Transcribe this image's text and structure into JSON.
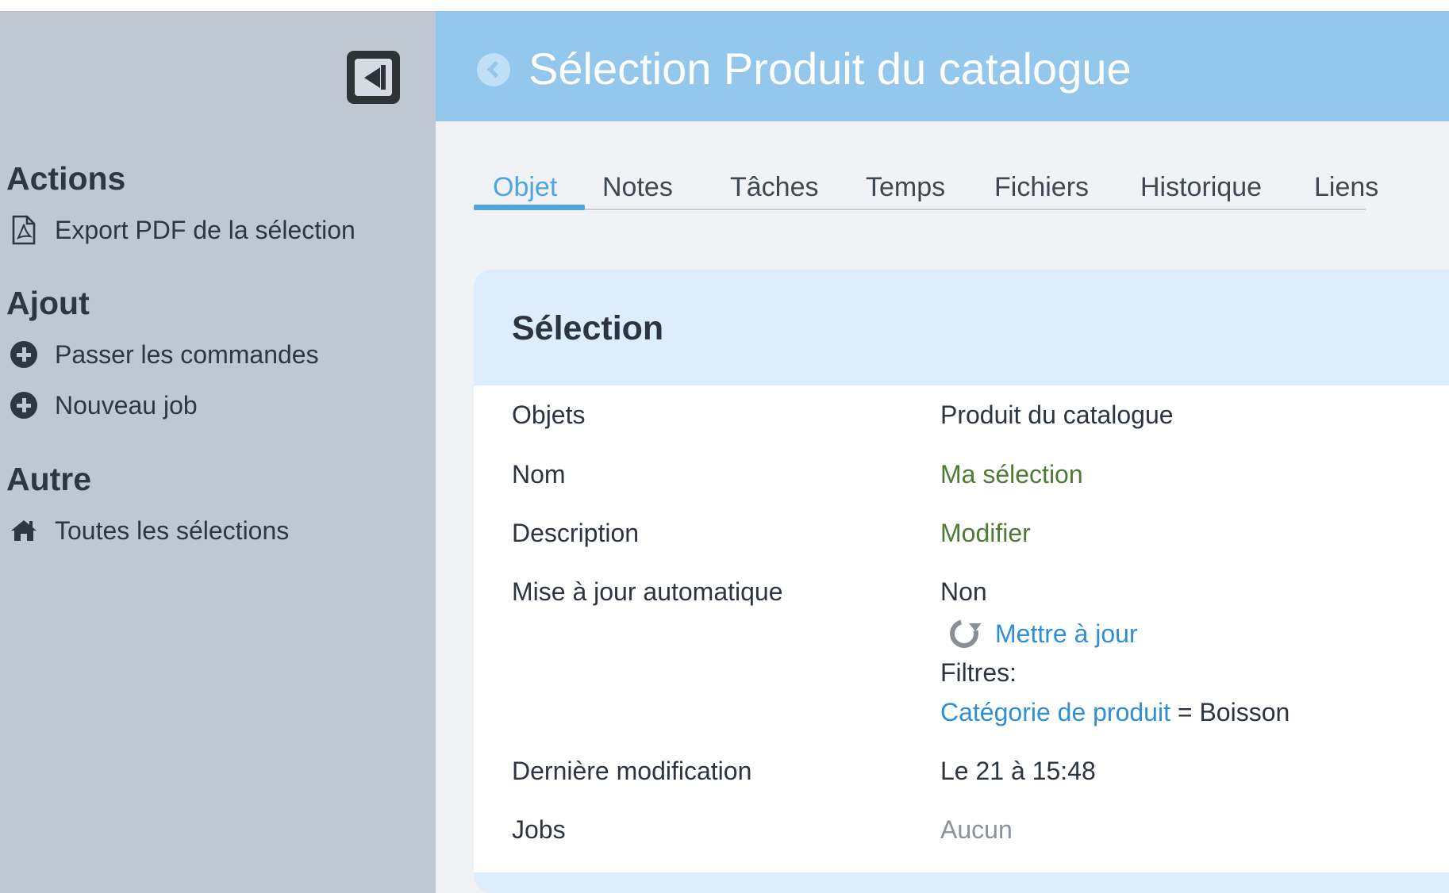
{
  "sidebar": {
    "sections": [
      {
        "title": "Actions",
        "items": [
          {
            "label": "Export PDF de la sélection",
            "icon": "pdf-file-icon"
          }
        ]
      },
      {
        "title": "Ajout",
        "items": [
          {
            "label": "Passer les commandes",
            "icon": "plus-circle-icon"
          },
          {
            "label": "Nouveau job",
            "icon": "plus-circle-icon"
          }
        ]
      },
      {
        "title": "Autre",
        "items": [
          {
            "label": "Toutes les sélections",
            "icon": "home-icon"
          }
        ]
      }
    ]
  },
  "header": {
    "title": "Sélection Produit du catalogue"
  },
  "tabs": [
    {
      "label": "Objet",
      "active": true
    },
    {
      "label": "Notes"
    },
    {
      "label": "Tâches"
    },
    {
      "label": "Temps"
    },
    {
      "label": "Fichiers"
    },
    {
      "label": "Historique"
    },
    {
      "label": "Liens"
    }
  ],
  "card": {
    "title": "Sélection",
    "rows": {
      "objets": {
        "label": "Objets",
        "value": "Produit du catalogue"
      },
      "nom": {
        "label": "Nom",
        "value": "Ma sélection"
      },
      "description": {
        "label": "Description",
        "value": "Modifier"
      },
      "maj": {
        "label": "Mise à jour automatique",
        "value": "Non",
        "refresh_label": "Mettre à jour",
        "filters_label": "Filtres:",
        "filter_field": "Catégorie de produit",
        "filter_op": "=",
        "filter_value": "Boisson"
      },
      "derniere": {
        "label": "Dernière modification",
        "value": "Le 21 à 15:48"
      },
      "jobs": {
        "label": "Jobs",
        "value": "Aucun"
      }
    }
  },
  "colors": {
    "sidebar": "#bfc7d1",
    "header": "#93c7ec",
    "accent": "#4fa6dc",
    "link": "#2f8fd6",
    "green_link": "#4d7a34"
  }
}
